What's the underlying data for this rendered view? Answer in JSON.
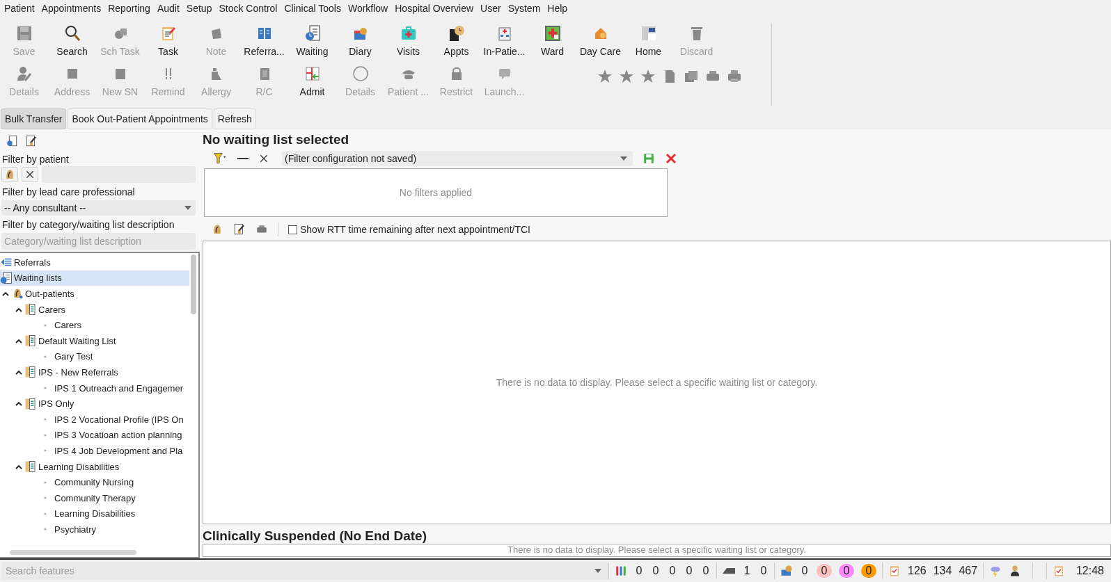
{
  "menu_bar": [
    "Patient",
    "Appointments",
    "Reporting",
    "Audit",
    "Setup",
    "Stock Control",
    "Clinical Tools",
    "Workflow",
    "Hospital Overview",
    "User",
    "System",
    "Help"
  ],
  "toolbar": {
    "row_1": [
      {
        "label": "Save",
        "disabled": true
      },
      {
        "label": "Search",
        "disabled": false
      },
      {
        "label": "Sch Task",
        "disabled": true
      },
      {
        "label": "Task",
        "disabled": false
      },
      {
        "label": "Note",
        "disabled": true
      },
      {
        "label": "Referra...",
        "disabled": false
      },
      {
        "label": "Waiting",
        "disabled": false
      },
      {
        "label": "Diary",
        "disabled": false
      },
      {
        "label": "Visits",
        "disabled": false
      },
      {
        "label": "Appts",
        "disabled": false
      },
      {
        "label": "In-Patie...",
        "disabled": false
      },
      {
        "label": "Ward",
        "disabled": false
      },
      {
        "label": "Day Care",
        "disabled": false
      },
      {
        "label": "Home",
        "disabled": false
      },
      {
        "label": "Discard",
        "disabled": true
      }
    ],
    "row_2": [
      {
        "label": "Details",
        "disabled": true
      },
      {
        "label": "Address",
        "disabled": true
      },
      {
        "label": "New SN",
        "disabled": true
      },
      {
        "label": "Remind",
        "disabled": true
      },
      {
        "label": "Allergy",
        "disabled": true
      },
      {
        "label": "R/C",
        "disabled": true
      },
      {
        "label": "Admit",
        "disabled": false
      },
      {
        "label": "Details",
        "disabled": true
      },
      {
        "label": "Patient ...",
        "disabled": true
      },
      {
        "label": "Restrict",
        "disabled": true
      },
      {
        "label": "Launch...",
        "disabled": true
      }
    ]
  },
  "action_buttons": [
    {
      "label": "Bulk Transfer",
      "selected": true
    },
    {
      "label": "Book Out-Patient Appointments",
      "selected": false
    },
    {
      "label": "Refresh",
      "selected": false
    }
  ],
  "sidebar": {
    "patient_filter": {
      "label": "Filter by patient"
    },
    "lead_filter": {
      "label": "Filter by lead care professional",
      "value": "-- Any consultant --"
    },
    "category_filter": {
      "label": "Filter by category/waiting list description",
      "placeholder": "Category/waiting list description"
    },
    "tree": [
      {
        "label": "Referrals",
        "kind": "referrals",
        "selected": false
      },
      {
        "label": "Waiting lists",
        "kind": "waiting",
        "selected": true
      },
      {
        "label": "Out-patients",
        "kind": "clinic",
        "selected": false,
        "expanded": true,
        "children": [
          {
            "label": "Carers",
            "kind": "list",
            "selected": false,
            "expanded": true,
            "children": [
              {
                "label": "Carers",
                "kind": "entry",
                "selected": false
              }
            ]
          },
          {
            "label": "Default Waiting List",
            "kind": "list",
            "selected": false,
            "expanded": true,
            "children": [
              {
                "label": "Gary Test",
                "kind": "entry",
                "selected": false
              }
            ]
          },
          {
            "label": "IPS - New Referrals",
            "kind": "list",
            "selected": false,
            "expanded": true,
            "children": [
              {
                "label": "IPS 1 Outreach and Engagemer",
                "kind": "entry",
                "selected": false
              }
            ]
          },
          {
            "label": "IPS Only",
            "kind": "list",
            "selected": false,
            "expanded": true,
            "children": [
              {
                "label": "IPS 2 Vocational Profile (IPS On",
                "kind": "entry",
                "selected": false
              },
              {
                "label": "IPS 3 Vocatioan action planning",
                "kind": "entry",
                "selected": false
              },
              {
                "label": "IPS 4 Job Development and Pla",
                "kind": "entry",
                "selected": false
              }
            ]
          },
          {
            "label": "Learning Disabilities",
            "kind": "list",
            "selected": false,
            "expanded": true,
            "children": [
              {
                "label": "Community Nursing",
                "kind": "entry",
                "selected": false
              },
              {
                "label": "Community Therapy",
                "kind": "entry",
                "selected": false
              },
              {
                "label": "Learning Disabilities",
                "kind": "entry",
                "selected": false
              },
              {
                "label": "Psychiatry",
                "kind": "entry",
                "selected": false
              }
            ]
          }
        ]
      }
    ]
  },
  "main": {
    "title": "No waiting list selected",
    "filter_config": "(Filter configuration not saved)",
    "filters_message": "No filters applied",
    "rtt_option": {
      "label": "Show RTT time remaining after next appointment/TCI",
      "checked": false
    },
    "grid_message": "There is no data to display. Please select a specific waiting list or category.",
    "suspended_title": "Clinically Suspended (No End Date)",
    "suspended_message": "There is no data to display. Please select a specific waiting list or category."
  },
  "status_bar": {
    "search": {
      "placeholder": "Search features"
    },
    "groups": [
      {
        "counts": [
          {
            "value": "0"
          },
          {
            "value": "0"
          },
          {
            "value": "0"
          },
          {
            "value": "0"
          },
          {
            "value": "0"
          }
        ]
      },
      {
        "counts": [
          {
            "value": "1"
          },
          {
            "value": "0"
          }
        ]
      },
      {
        "counts": [
          {
            "value": "0"
          },
          {
            "value": "0",
            "color": "#ffc0c0"
          },
          {
            "value": "0",
            "color": "#ff88ff"
          },
          {
            "value": "0",
            "color": "#ff9900"
          }
        ]
      },
      {
        "counts": [
          {
            "value": "126"
          },
          {
            "value": "134"
          },
          {
            "value": "467"
          }
        ]
      }
    ],
    "time": "12:48"
  }
}
